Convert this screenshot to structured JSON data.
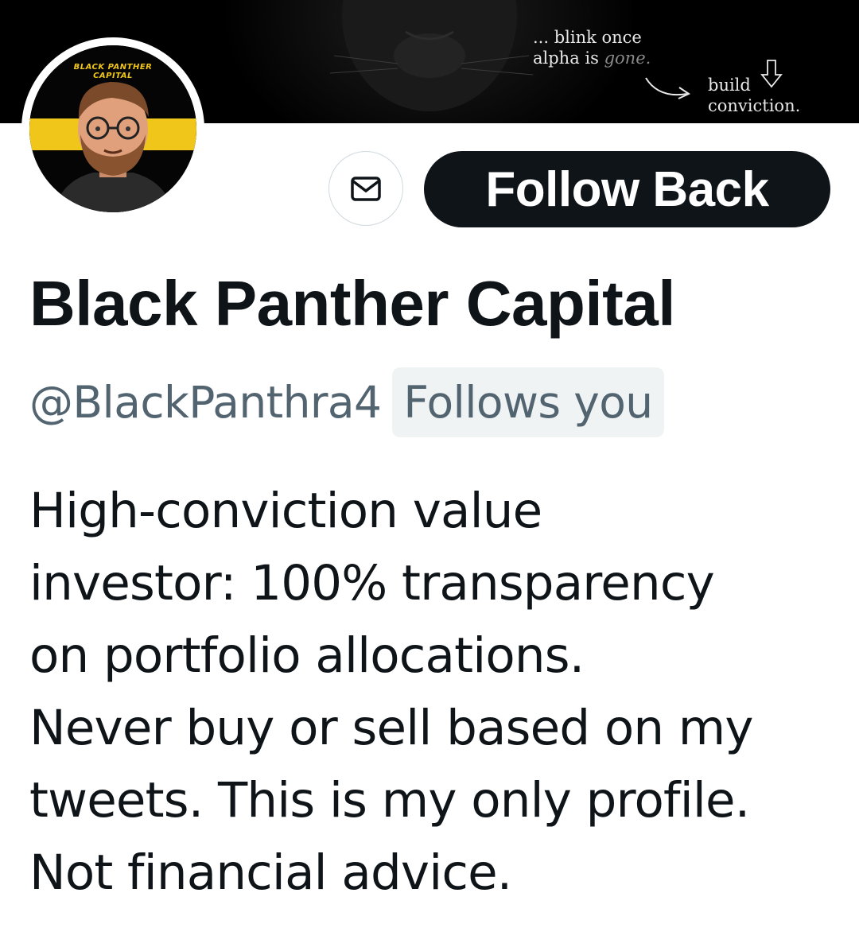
{
  "banner": {
    "line1": "... blink once",
    "line2_prefix": "alpha is ",
    "line2_gone": "gone.",
    "line3": "build",
    "line4": "conviction."
  },
  "avatar": {
    "logo_line1": "BLACK PANTHER",
    "logo_line2": "CAPITAL",
    "stripe_color": "#f0c61a"
  },
  "actions": {
    "message_icon": "envelope-icon",
    "follow_label": "Follow Back"
  },
  "profile": {
    "display_name": "Black Panther Capital",
    "handle": "@BlackPanthra4",
    "follows_you_badge": "Follows you",
    "bio_lines": [
      "High-conviction value",
      "investor: 100% transparency",
      "on portfolio allocations.",
      "Never buy or sell based on my",
      "tweets. This is my only profile.",
      "Not financial advice."
    ]
  },
  "colors": {
    "text_primary": "#0f1419",
    "text_secondary": "#536471",
    "badge_bg": "#eff3f4",
    "button_bg": "#0f1419",
    "border": "#cfd9de"
  }
}
